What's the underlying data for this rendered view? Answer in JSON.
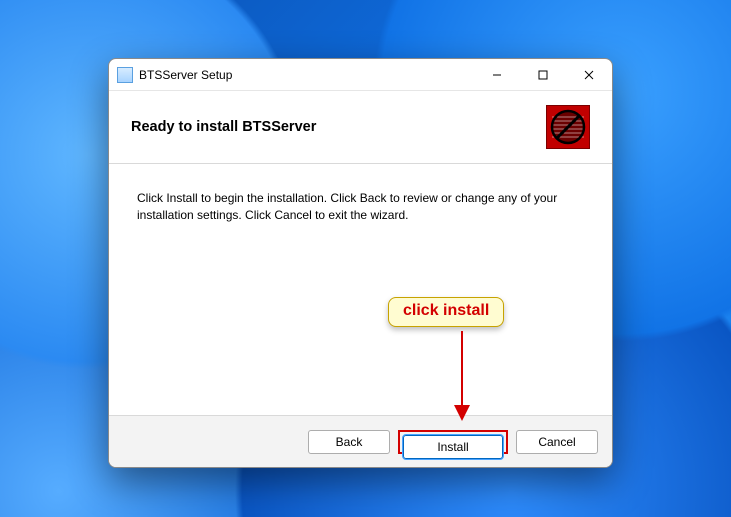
{
  "window": {
    "title": "BTSServer Setup"
  },
  "header": {
    "heading": "Ready to install BTSServer"
  },
  "body": {
    "instruction": "Click Install to begin the installation. Click Back to review or change any of your installation settings. Click Cancel to exit the wizard."
  },
  "footer": {
    "back_label": "Back",
    "install_label": "Install",
    "cancel_label": "Cancel"
  },
  "annotation": {
    "text": "click install"
  },
  "colors": {
    "accent_red": "#d30000",
    "callout_bg": "#fffcd1"
  }
}
